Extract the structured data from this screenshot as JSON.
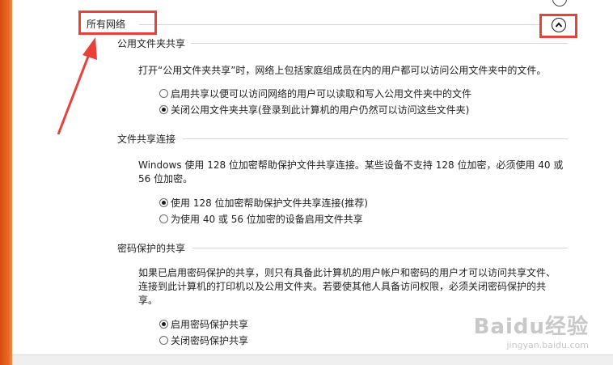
{
  "group": {
    "title": "所有网络",
    "collapse_icon": "chevron-up-icon"
  },
  "public_folder": {
    "title": "公用文件夹共享",
    "description": "打开“公用文件夹共享”时，网络上包括家庭组成员在内的用户都可以访问公用文件夹中的文件。",
    "options": [
      {
        "label": "启用共享以便可以访问网络的用户可以读取和写入公用文件夹中的文件",
        "checked": false
      },
      {
        "label": "关闭公用文件夹共享(登录到此计算机的用户仍然可以访问这些文件夹)",
        "checked": true
      }
    ]
  },
  "file_sharing": {
    "title": "文件共享连接",
    "description_line1": "Windows 使用 128 位加密帮助保护文件共享连接。某些设备不支持 128 位加密，必须使用 40 或",
    "description_line2": "56 位加密。",
    "options": [
      {
        "label": "使用 128 位加密帮助保护文件共享连接(推荐)",
        "checked": true
      },
      {
        "label": "为使用 40 或 56 位加密的设备启用文件共享",
        "checked": false
      }
    ]
  },
  "password_sharing": {
    "title": "密码保护的共享",
    "description_line1": "如果已启用密码保护的共享，则只有具备此计算机的用户帐户和密码的用户才可以访问共享文件、",
    "description_line2": "连接到此计算机的打印机以及公用文件夹。若要使其他人具备访问权限，必须关闭密码保护的共",
    "description_line3": "享。",
    "options": [
      {
        "label": "启用密码保护共享",
        "checked": true
      },
      {
        "label": "关闭密码保护共享",
        "checked": false
      }
    ]
  },
  "watermark": {
    "brand": "Baidu经验",
    "url": "jingyan.baidu.com"
  },
  "colors": {
    "annotation_red": "#e8413c",
    "left_strip": "#e25a1c"
  }
}
